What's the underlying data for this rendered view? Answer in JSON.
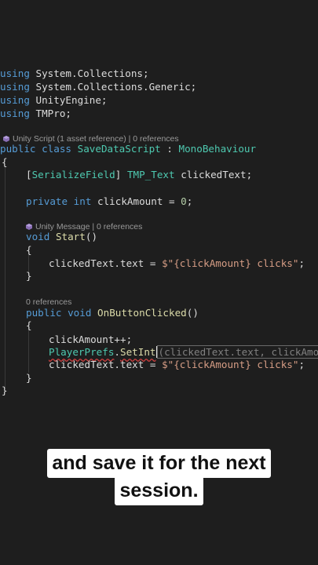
{
  "code": {
    "using_keyword": "using",
    "usings": [
      "System.Collections;",
      "System.Collections.Generic;",
      "UnityEngine;",
      "TMPro;"
    ],
    "class_lens": "Unity Script (1 asset reference) | 0 references",
    "class_decl": {
      "public": "public",
      "class": "class",
      "name": "SaveDataScript",
      "colon": " : ",
      "base": "MonoBehaviour"
    },
    "open_brace": "{",
    "close_brace": "}",
    "field1": {
      "bracket_open": "[",
      "attr": "SerializeField",
      "bracket_close": "]",
      "type": "TMP_Text",
      "name": " clickedText;"
    },
    "field2": {
      "mod": "private",
      "type": "int",
      "name": " clickAmount = ",
      "value": "0",
      "end": ";"
    },
    "start_lens": "Unity Message | 0 references",
    "start_decl": {
      "void": "void",
      "name": "Start",
      "parens": "()"
    },
    "start_body": {
      "obj": "clickedText.text = ",
      "string": "$\"{clickAmount} clicks\"",
      "end": ";"
    },
    "method_lens": "0 references",
    "method_decl": {
      "public": "public",
      "void": "void",
      "name": "OnButtonClicked",
      "parens": "()"
    },
    "method_body": {
      "line1": "clickAmount++;",
      "prefs_class": "PlayerPrefs",
      "dot": ".",
      "prefs_method": "SetInt",
      "param_hint": "(clickedText.text, clickAmou",
      "line3_obj": "clickedText.text = ",
      "line3_string": "$\"{clickAmount} clicks\"",
      "line3_end": ";"
    }
  },
  "caption": {
    "line1": "and save it for the next",
    "line2": "session."
  },
  "colors": {
    "background": "#1e1e1e",
    "keyword": "#569cd6",
    "type": "#4ec9b0",
    "method": "#dcdcaa",
    "number": "#b5cea8",
    "string": "#d69d85"
  }
}
